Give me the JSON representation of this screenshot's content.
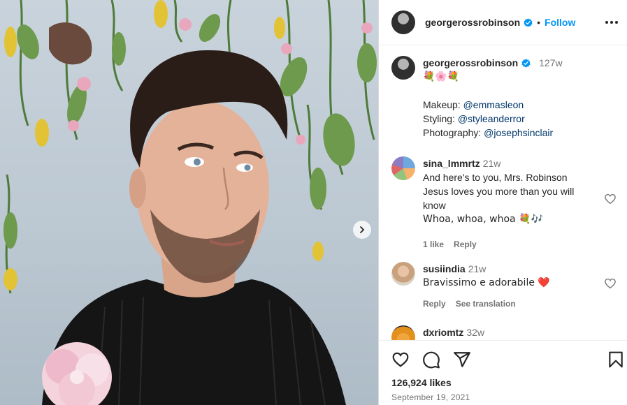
{
  "post": {
    "username": "georgerossrobinson",
    "follow_label": "Follow",
    "separator": "•"
  },
  "caption": {
    "username": "georgerossrobinson",
    "age": "127w",
    "emojis": "💐🌸💐",
    "lines": [
      {
        "label": "Makeup: ",
        "handle": "@emmasleon"
      },
      {
        "label": "Styling: ",
        "handle": "@styleanderror"
      },
      {
        "label": "Photography: ",
        "handle": "@josephsinclair"
      }
    ]
  },
  "comments": [
    {
      "username": "sina_lmmrtz",
      "age": "21w",
      "lines": [
        "And here's to you, Mrs. Robinson",
        "Jesus loves you more than you will",
        "know",
        "Whoa, whoa, whoa 💐🎶"
      ],
      "action1": "1 like",
      "action2": "Reply"
    },
    {
      "username": "susiindia",
      "age": "21w",
      "lines": [
        "Bravissimo e adorabile ❤️"
      ],
      "action1": "Reply",
      "action2": "See translation"
    },
    {
      "username": "dxriomtz",
      "age": "32w",
      "lines": []
    }
  ],
  "footer": {
    "likes": "126,924 likes",
    "date": "September 19, 2021"
  },
  "colors": {
    "accent": "#0095f6",
    "link": "#00376b",
    "heart": "#ed4956",
    "muted": "#737373"
  }
}
